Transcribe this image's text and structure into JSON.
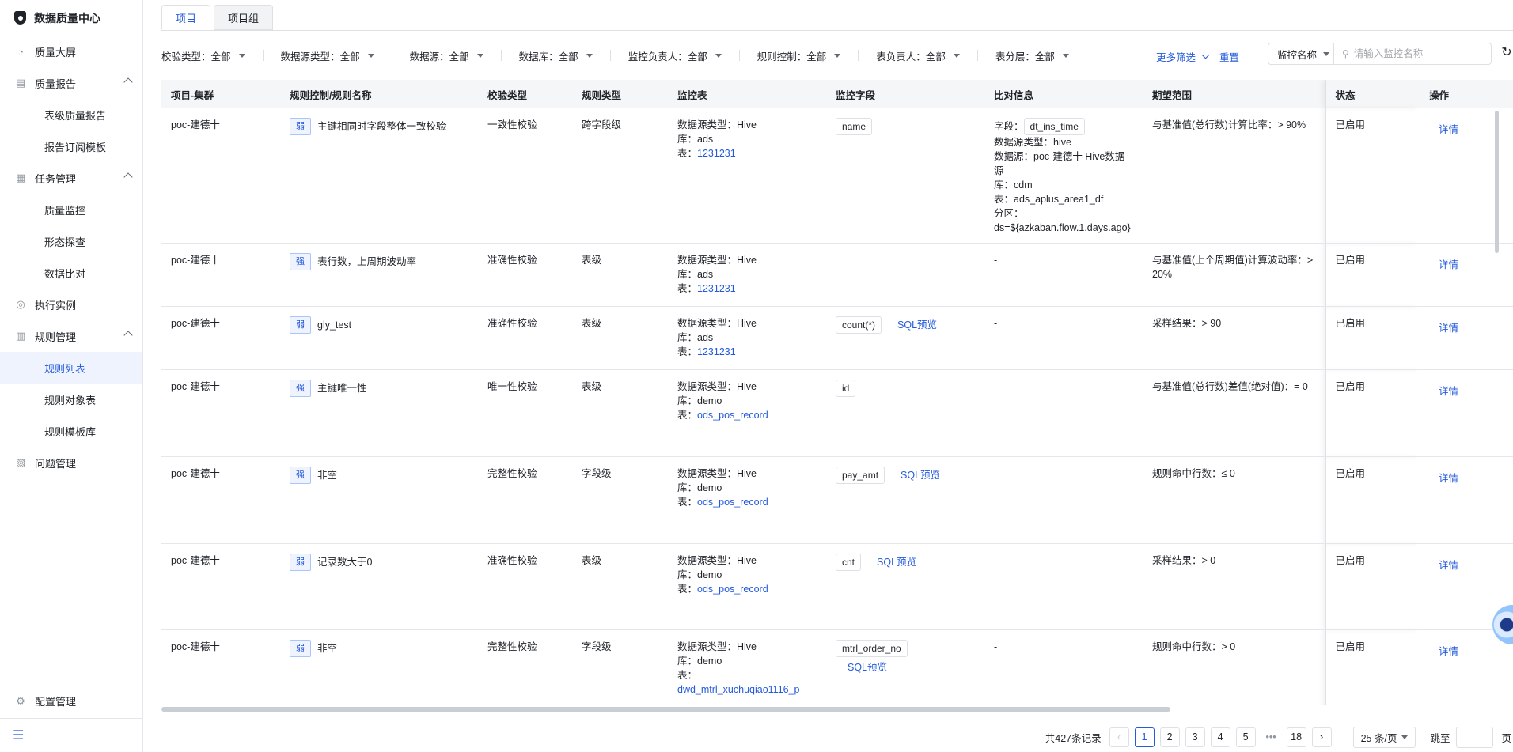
{
  "app": {
    "title": "数据质量中心"
  },
  "sidebar": {
    "items": [
      {
        "label": "质量大屏",
        "icon": "dashboard-icon"
      },
      {
        "label": "质量报告",
        "icon": "report-icon",
        "expanded": true,
        "children": [
          "表级质量报告",
          "报告订阅模板"
        ]
      },
      {
        "label": "任务管理",
        "icon": "task-icon",
        "expanded": true,
        "children": [
          "质量监控",
          "形态探查",
          "数据比对"
        ]
      },
      {
        "label": "执行实例",
        "icon": "instance-icon"
      },
      {
        "label": "规则管理",
        "icon": "rule-icon",
        "expanded": true,
        "children": [
          "规则列表",
          "规则对象表",
          "规则模板库"
        ]
      },
      {
        "label": "问题管理",
        "icon": "issue-icon"
      }
    ],
    "active_child": "规则列表",
    "config_label": "配置管理"
  },
  "tabs": [
    {
      "label": "项目",
      "active": true
    },
    {
      "label": "项目组",
      "active": false
    }
  ],
  "filters": [
    {
      "label": "校验类型",
      "value": "全部"
    },
    {
      "label": "数据源类型",
      "value": "全部"
    },
    {
      "label": "数据源",
      "value": "全部"
    },
    {
      "label": "数据库",
      "value": "全部"
    },
    {
      "label": "监控负责人",
      "value": "全部"
    },
    {
      "label": "规则控制",
      "value": "全部"
    },
    {
      "label": "表负责人",
      "value": "全部"
    },
    {
      "label": "表分层",
      "value": "全部"
    }
  ],
  "toolbar": {
    "more_filter": "更多筛选",
    "reset": "重置",
    "monitor_select": "监控名称",
    "search_placeholder": "请输入监控名称"
  },
  "table": {
    "headers": [
      "项目-集群",
      "规则控制/规则名称",
      "校验类型",
      "规则类型",
      "监控表",
      "监控字段",
      "比对信息",
      "期望范围",
      "状态",
      "操作"
    ],
    "rows": [
      {
        "project": "poc-建德十",
        "tag": "弱",
        "name": "主键相同时字段整体一致校验",
        "check_type": "一致性校验",
        "rule_type": "跨字段级",
        "ds_type": "数据源类型：Hive",
        "db": "库：ads",
        "table_prefix": "表：",
        "table": "1231231",
        "field": "name",
        "sql": "",
        "compare_label": "字段：",
        "compare_chip": "dt_ins_time",
        "compare_lines": [
          "数据源类型：hive",
          "数据源：poc-建德十 Hive数据源",
          "库：cdm",
          "表：ads_aplus_area1_df",
          "分区：ds=${azkaban.flow.1.days.ago}"
        ],
        "expect": "与基准值(总行数)计算比率：> 90%",
        "status": "已启用",
        "action": "详情"
      },
      {
        "project": "poc-建德十",
        "tag": "强",
        "name": "表行数，上周期波动率",
        "check_type": "准确性校验",
        "rule_type": "表级",
        "ds_type": "数据源类型：Hive",
        "db": "库：ads",
        "table_prefix": "表：",
        "table": "1231231",
        "field": "",
        "sql": "",
        "compare_label": "",
        "compare_chip": "",
        "compare_lines": [
          "-"
        ],
        "expect": "与基准值(上个周期值)计算波动率：> 20%",
        "status": "已启用",
        "action": "详情"
      },
      {
        "project": "poc-建德十",
        "tag": "弱",
        "name": "gly_test",
        "check_type": "准确性校验",
        "rule_type": "表级",
        "ds_type": "数据源类型：Hive",
        "db": "库：ads",
        "table_prefix": "表：",
        "table": "1231231",
        "field": "count(*)",
        "sql": "SQL预览",
        "compare_label": "",
        "compare_chip": "",
        "compare_lines": [
          "-"
        ],
        "expect": "采样结果：> 90",
        "status": "已启用",
        "action": "详情"
      },
      {
        "project": "poc-建德十",
        "tag": "强",
        "name": "主键唯一性",
        "check_type": "唯一性校验",
        "rule_type": "表级",
        "ds_type": "数据源类型：Hive",
        "db": "库：demo",
        "table_prefix": "表：",
        "table": "ods_pos_record",
        "field": "id",
        "sql": "",
        "compare_label": "",
        "compare_chip": "",
        "compare_lines": [
          "-"
        ],
        "expect": "与基准值(总行数)差值(绝对值)：= 0",
        "status": "已启用",
        "action": "详情"
      },
      {
        "project": "poc-建德十",
        "tag": "强",
        "name": "非空",
        "check_type": "完整性校验",
        "rule_type": "字段级",
        "ds_type": "数据源类型：Hive",
        "db": "库：demo",
        "table_prefix": "表：",
        "table": "ods_pos_record",
        "field": "pay_amt",
        "sql": "SQL预览",
        "compare_label": "",
        "compare_chip": "",
        "compare_lines": [
          "-"
        ],
        "expect": "规则命中行数：≤ 0",
        "status": "已启用",
        "action": "详情"
      },
      {
        "project": "poc-建德十",
        "tag": "弱",
        "name": "记录数大于0",
        "check_type": "准确性校验",
        "rule_type": "表级",
        "ds_type": "数据源类型：Hive",
        "db": "库：demo",
        "table_prefix": "表：",
        "table": "ods_pos_record",
        "field": "cnt",
        "sql": "SQL预览",
        "compare_label": "",
        "compare_chip": "",
        "compare_lines": [
          "-"
        ],
        "expect": "采样结果：> 0",
        "status": "已启用",
        "action": "详情"
      },
      {
        "project": "poc-建德十",
        "tag": "弱",
        "name": "非空",
        "check_type": "完整性校验",
        "rule_type": "字段级",
        "ds_type": "数据源类型：Hive",
        "db": "库：demo",
        "table_prefix": "表：",
        "table": "dwd_mtrl_xuchuqiao1116_p",
        "field": "mtrl_order_no",
        "sql": "SQL预览",
        "compare_label": "",
        "compare_chip": "",
        "compare_lines": [
          "-"
        ],
        "expect": "规则命中行数：> 0",
        "status": "已启用",
        "action": "详情"
      }
    ]
  },
  "pagination": {
    "total": "共427条记录",
    "pages": [
      "1",
      "2",
      "3",
      "4",
      "5",
      "•••",
      "18"
    ],
    "current": "1",
    "page_size": "25 条/页",
    "jump_label": "跳至",
    "page_label": "页"
  },
  "colors": {
    "accent": "#245bdb",
    "active_bg": "#eef3fe",
    "header_bg": "#f5f6f7",
    "border": "#dee0e3"
  }
}
